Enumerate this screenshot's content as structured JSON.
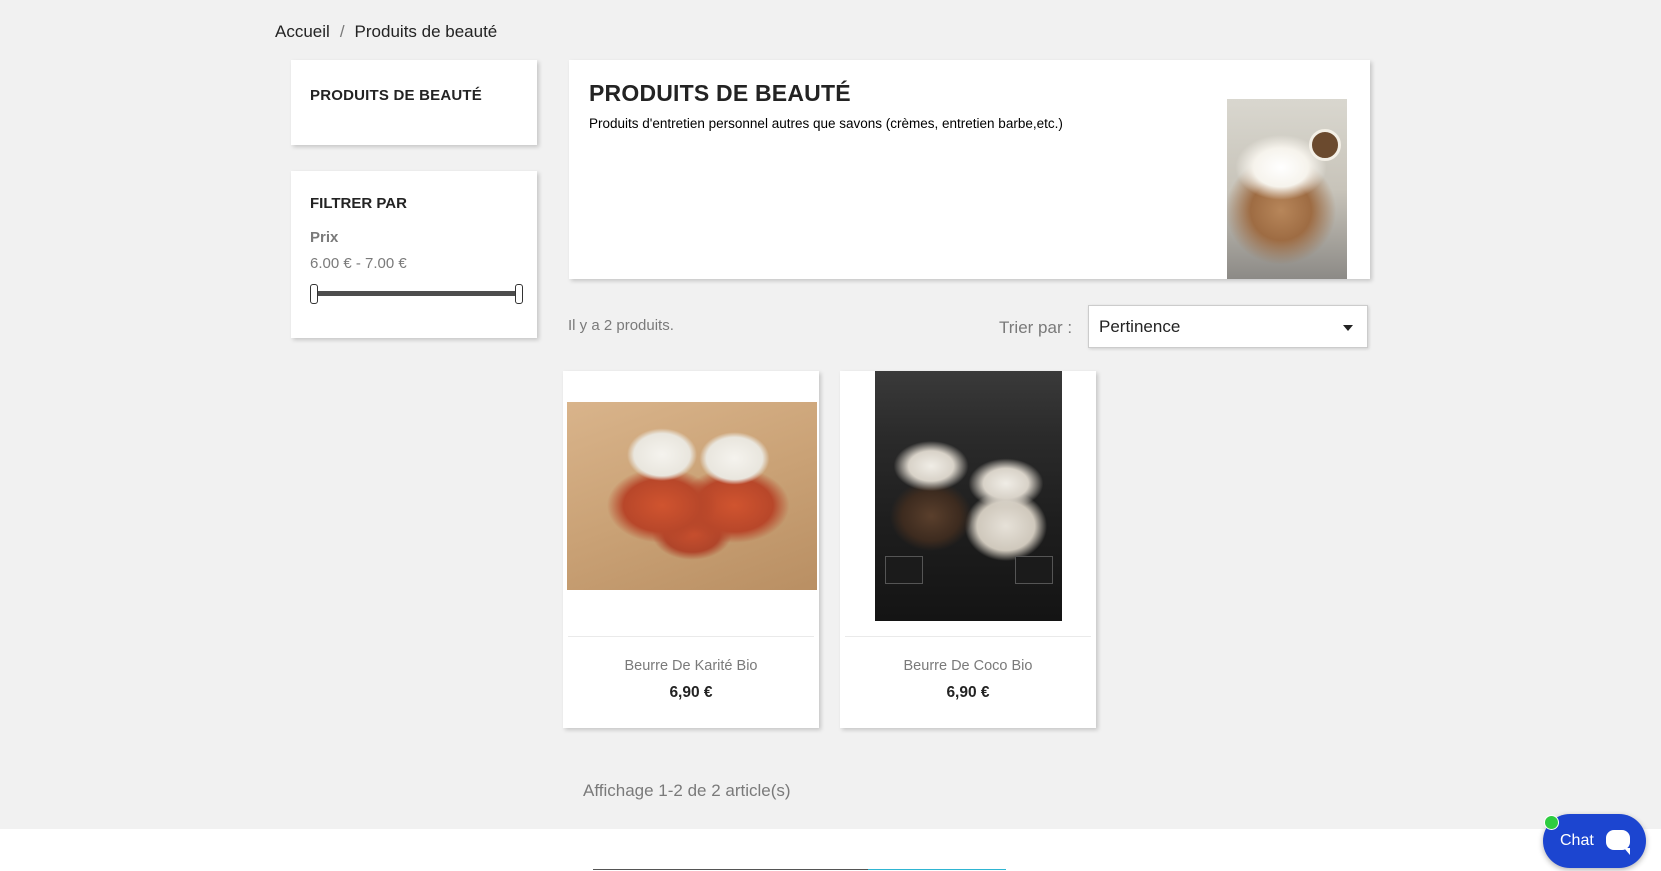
{
  "breadcrumb": {
    "home": "Accueil",
    "separator": "/",
    "current": "Produits de beauté"
  },
  "sidebar": {
    "category_title": "PRODUITS DE BEAUTÉ",
    "filter": {
      "title": "FILTRER PAR",
      "facet_label": "Prix",
      "range_text": "6.00 € - 7.00 €",
      "min_value": 6.0,
      "max_value": 7.0
    }
  },
  "category": {
    "title": "PRODUITS DE BEAUTÉ",
    "description": "Produits d'entretien personnel autres que savons (crèmes, entretien barbe,etc.)"
  },
  "listing": {
    "count_text": "Il y a 2 produits.",
    "sort_label": "Trier par :",
    "sort_value": "Pertinence",
    "products": [
      {
        "name": "Beurre De Karité Bio",
        "price": "6,90 €"
      },
      {
        "name": "Beurre De Coco Bio",
        "price": "6,90 €"
      }
    ],
    "pagination_text": "Affichage 1-2 de 2 article(s)"
  },
  "chat": {
    "label": "Chat",
    "status_color": "#2ecc40",
    "button_color": "#1c45d0"
  },
  "icons": [
    "chevron-down-icon",
    "chat-bubble-icon",
    "online-status-icon"
  ]
}
